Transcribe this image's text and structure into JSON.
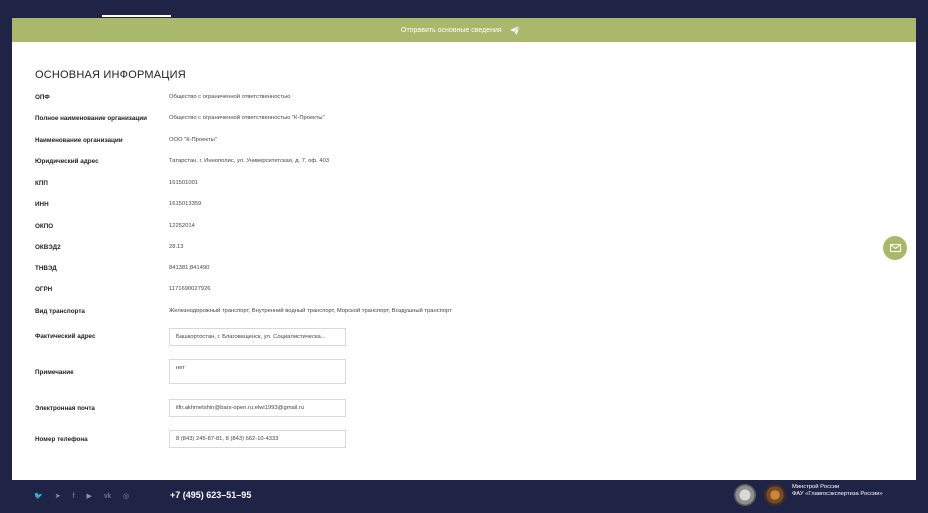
{
  "action_bar": {
    "send_label": "Отправить основные сведения"
  },
  "section_title": "ОСНОВНАЯ ИНФОРМАЦИЯ",
  "rows": [
    {
      "label": "ОПФ",
      "value": "Общество с ограниченной ответственностью"
    },
    {
      "label": "Полное наименование организации",
      "value": "Общество с ограниченной ответственностью \"К-Проекты\""
    },
    {
      "label": "Наименование организации",
      "value": "ООО \"К-Проекты\""
    },
    {
      "label": "Юридический адрес",
      "value": "Татарстан, г. Иннополис, ул. Университетская, д. 7, оф. 403"
    },
    {
      "label": "КПП",
      "value": "161501001"
    },
    {
      "label": "ИНН",
      "value": "1615013359"
    },
    {
      "label": "ОКПО",
      "value": "12252014"
    },
    {
      "label": "ОКВЭД2",
      "value": "28.13"
    },
    {
      "label": "ТНВЭД",
      "value": "841381;841490"
    },
    {
      "label": "ОГРН",
      "value": "1171690027926"
    },
    {
      "label": "Вид транспорта",
      "value": "Железнодорожный транспорт, Внутренний водный транспорт, Морской транспорт, Воздушный транспорт"
    }
  ],
  "fields": {
    "actual_address": {
      "label": "Фактический адрес",
      "value": "Башкортостан, г. Благовещенск, ул. Социалистическа..."
    },
    "note": {
      "label": "Примечание",
      "value": "нет"
    },
    "email": {
      "label": "Электронная почта",
      "value": "ilfir.akhmetshin@bars-open.ru;elwi1993@gmail.ru"
    },
    "phone": {
      "label": "Номер телефона",
      "value": "8 (843) 245-87-81, 8 (843) 662-10-4333"
    }
  },
  "footer": {
    "social_icons": [
      "twitter-icon",
      "telegram-icon",
      "facebook-icon",
      "youtube-icon",
      "vk-icon",
      "instagram-icon"
    ],
    "phone": "+7 (495) 623–51–95",
    "ministry_line1": "Минстрой России",
    "ministry_line2": "ФАУ «Главгосэкспертиза России»"
  },
  "colors": {
    "accent": "#a9b86a",
    "navy": "#1f2346"
  }
}
